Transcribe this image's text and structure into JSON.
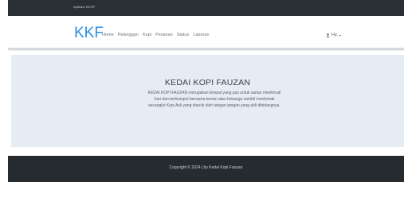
{
  "topbar": {
    "app_title": "Aplikasi KKOP"
  },
  "navbar": {
    "brand": "KKF",
    "menu": [
      "Home",
      "Pelanggan",
      "Kopi",
      "Pesanan",
      "Status",
      "Laporan"
    ],
    "user_label": "Hy,",
    "user_icon": "user-icon"
  },
  "hero": {
    "title": "KEDAI KOPI FAUZAN",
    "description": "KEDAI KOPI FAUZAN merupakan tempat yang pas untuk santai menikmati hari dan berkumpul bersama teman atau keluarga sambil menikmati secangkir Kopi Asli yang diracik oleh tangan-tangan yang ahli dibidangnya."
  },
  "footer": {
    "copyright": "Copyright © 2024 | by Kedai Kopi Fauzan"
  },
  "colors": {
    "brand": "#2e8de0",
    "topbar": "#2a2f36",
    "hero_bg": "#e6ecf3",
    "footer_bg": "#262b30"
  }
}
